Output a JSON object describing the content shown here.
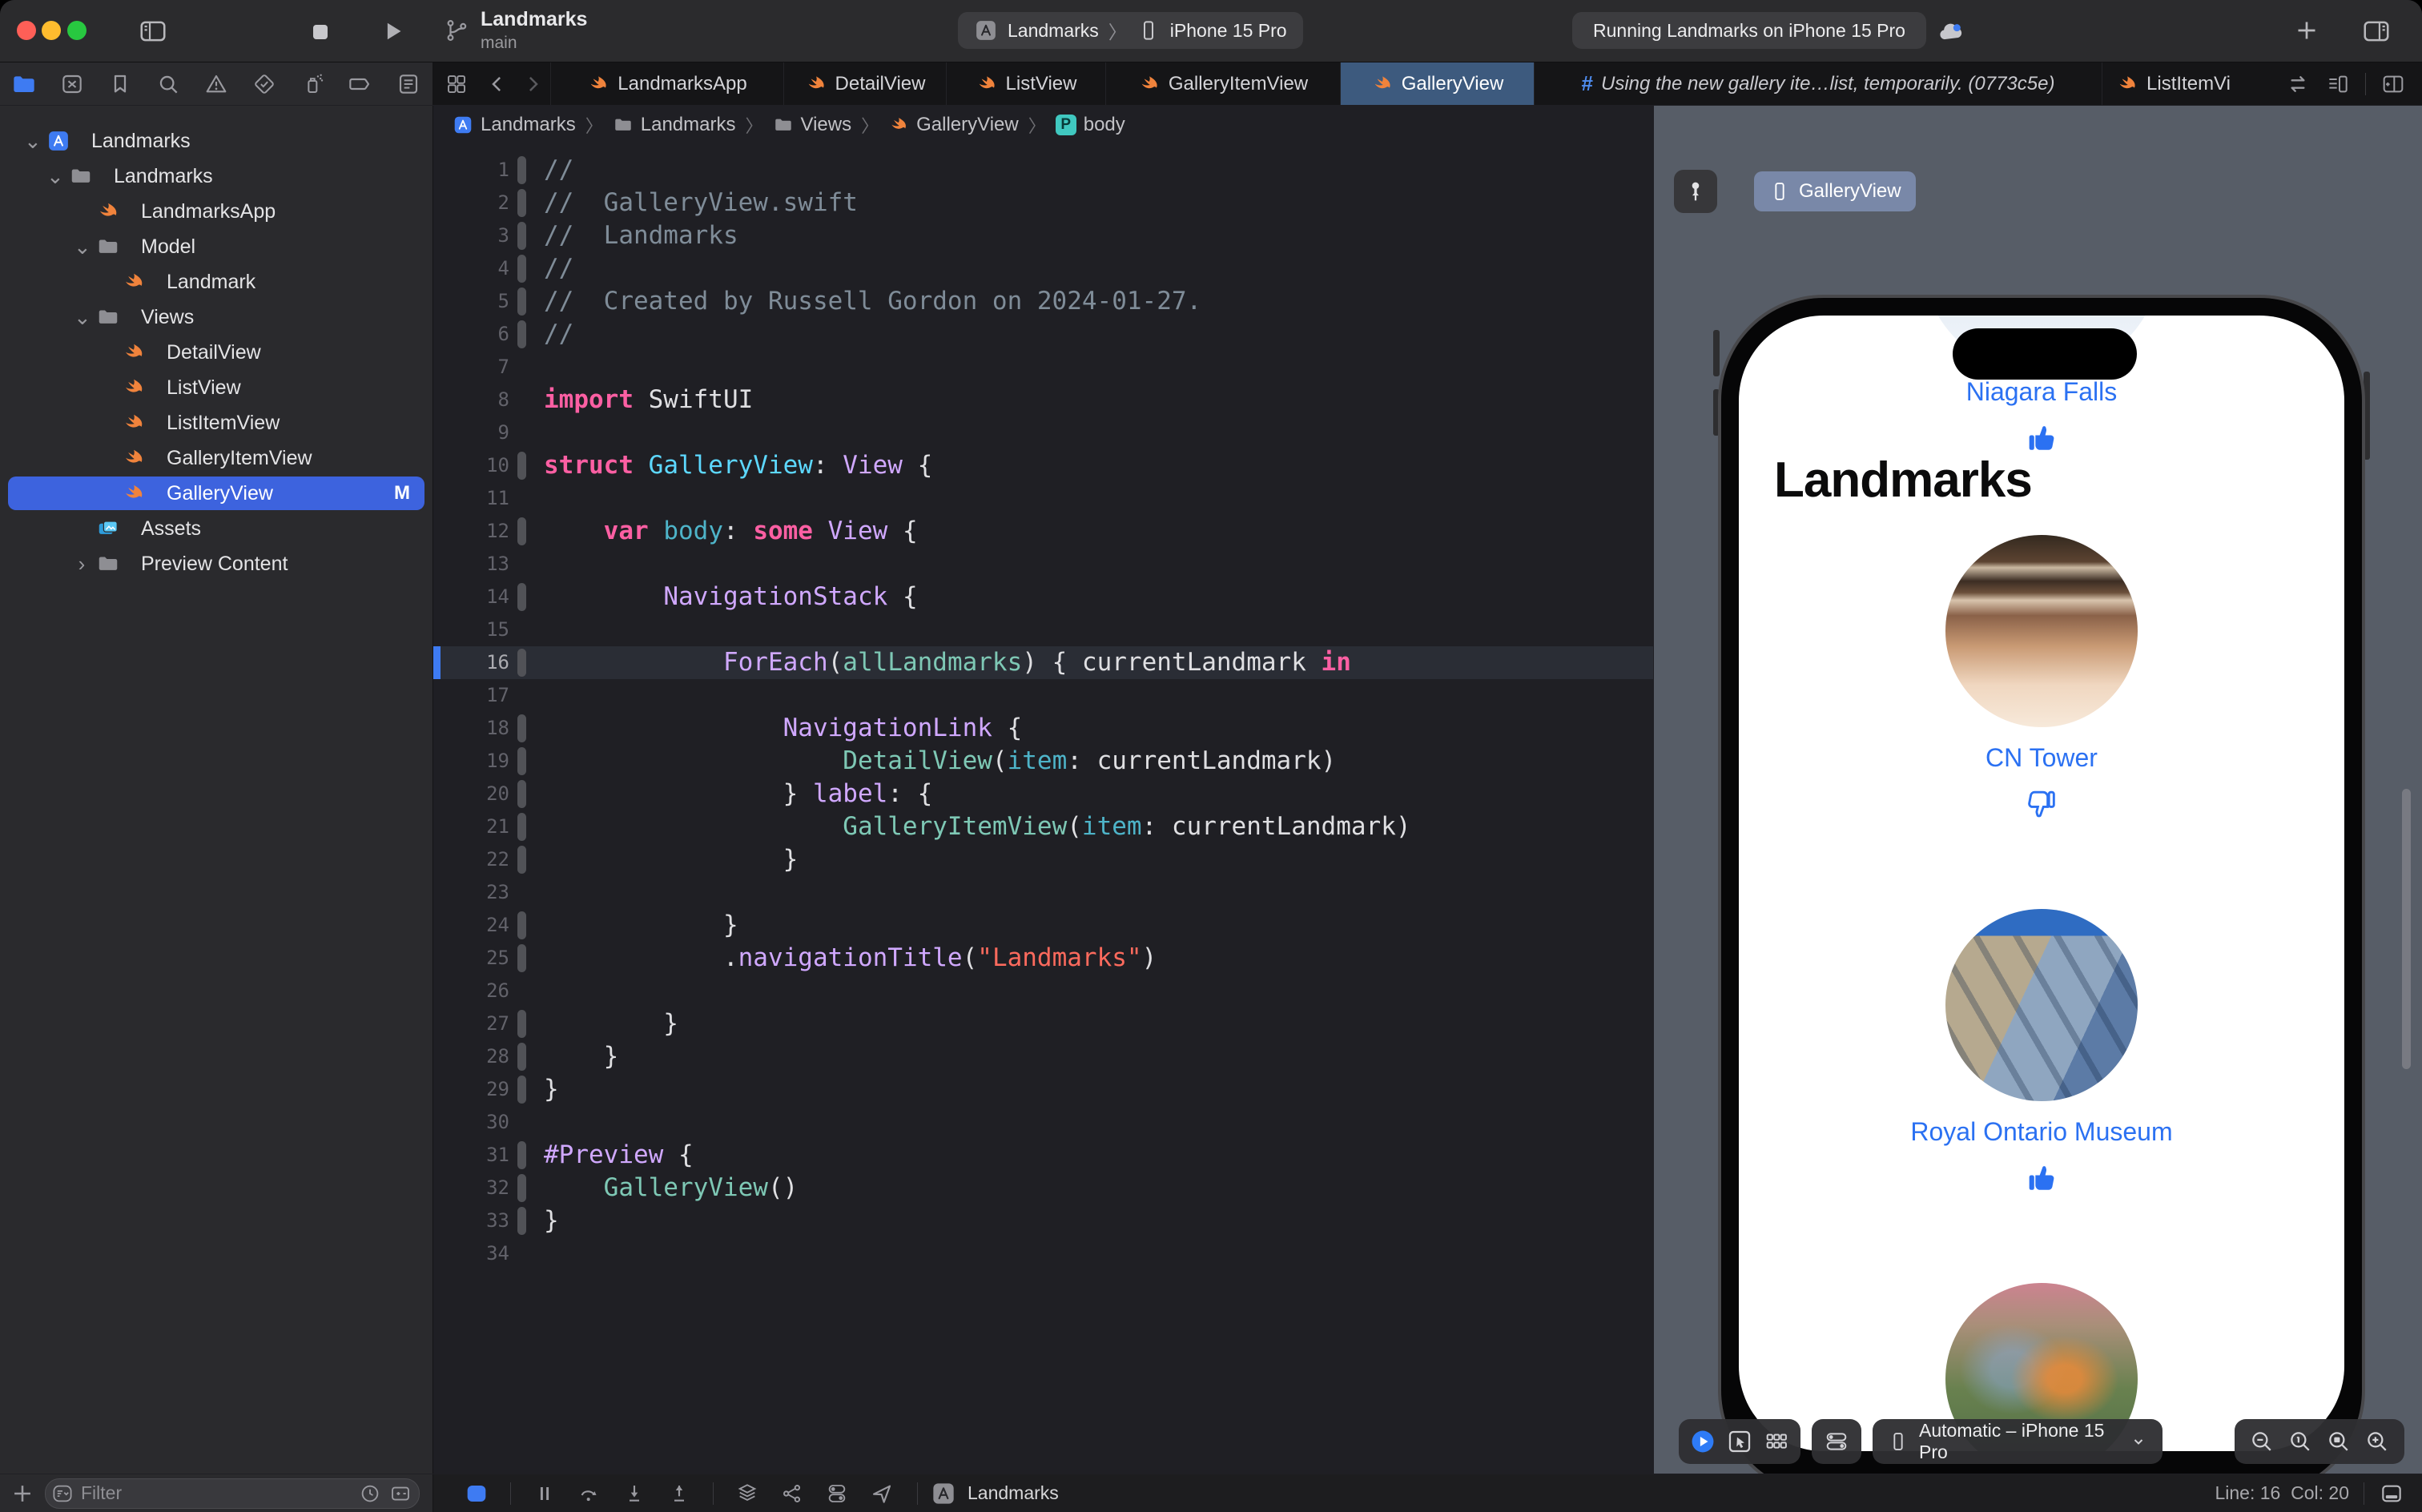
{
  "titlebar": {
    "traffic_lights": [
      "close",
      "minimize",
      "zoom"
    ],
    "toolbar_icons": [
      "sidebar-toggle",
      "stop-button",
      "run-button"
    ],
    "scheme_project": "Landmarks",
    "scheme_branch": "main",
    "run_destination": {
      "app": "Landmarks",
      "separator": "〉",
      "device": "iPhone 15 Pro"
    },
    "activity_status": "Running Landmarks on iPhone 15 Pro",
    "right_icons": [
      "cloud-sync",
      "add-tab",
      "right-panel-toggle"
    ]
  },
  "navigator": {
    "strip": [
      "project-navigator-folder",
      "source-control",
      "bookmarks",
      "find",
      "issues",
      "tests",
      "debug-gauge",
      "breakpoints",
      "reports"
    ],
    "tree": [
      {
        "label": "Landmarks",
        "icon": "appstore",
        "level": 0,
        "chevron": "down"
      },
      {
        "label": "Landmarks",
        "icon": "folder",
        "level": 1,
        "chevron": "down"
      },
      {
        "label": "LandmarksApp",
        "icon": "swift",
        "level": 2
      },
      {
        "label": "Model",
        "icon": "folder",
        "level": 2,
        "chevron": "down"
      },
      {
        "label": "Landmark",
        "icon": "swift",
        "level": 3
      },
      {
        "label": "Views",
        "icon": "folder",
        "level": 2,
        "chevron": "down"
      },
      {
        "label": "DetailView",
        "icon": "swift",
        "level": 3
      },
      {
        "label": "ListView",
        "icon": "swift",
        "level": 3
      },
      {
        "label": "ListItemView",
        "icon": "swift",
        "level": 3
      },
      {
        "label": "GalleryItemView",
        "icon": "swift",
        "level": 3
      },
      {
        "label": "GalleryView",
        "icon": "swift",
        "level": 3,
        "selected": true,
        "badge": "M"
      },
      {
        "label": "Assets",
        "icon": "assets",
        "level": 2
      },
      {
        "label": "Preview Content",
        "icon": "folder",
        "level": 2,
        "chevron": "right"
      }
    ],
    "filter_placeholder": "Filter",
    "filter_icons": [
      "add",
      "filter-menu",
      "clock",
      "add-remove-box"
    ]
  },
  "tabbar": {
    "left_icons": [
      "related-items-grid",
      "back-chevron",
      "forward-chevron"
    ],
    "tabs": [
      {
        "label": "LandmarksApp",
        "icon": "swift"
      },
      {
        "label": "DetailView",
        "icon": "swift"
      },
      {
        "label": "ListView",
        "icon": "swift"
      },
      {
        "label": "GalleryItemView",
        "icon": "swift"
      },
      {
        "label": "GalleryView",
        "icon": "swift",
        "active": true
      },
      {
        "label": "Using the new gallery ite…list, temporarily. (0773c5e)",
        "icon": "hash",
        "italic": true
      },
      {
        "label": "ListItemVi",
        "icon": "swift",
        "clipped": true
      }
    ],
    "right_icons": [
      "swap-editors",
      "editor-options",
      "add-editor"
    ]
  },
  "breadcrumb": {
    "items": [
      {
        "icon": "appstore",
        "label": "Landmarks"
      },
      {
        "icon": "folder",
        "label": "Landmarks"
      },
      {
        "icon": "folder",
        "label": "Views"
      },
      {
        "icon": "swift",
        "label": "GalleryView"
      },
      {
        "icon": "p-badge",
        "label": "body"
      }
    ]
  },
  "editor": {
    "current_line": 16,
    "lines": [
      {
        "n": 1,
        "bar": true,
        "tokens": [
          [
            "cm",
            "//"
          ]
        ]
      },
      {
        "n": 2,
        "bar": true,
        "tokens": [
          [
            "cm",
            "//  GalleryView.swift"
          ]
        ]
      },
      {
        "n": 3,
        "bar": true,
        "tokens": [
          [
            "cm",
            "//  Landmarks"
          ]
        ]
      },
      {
        "n": 4,
        "bar": true,
        "tokens": [
          [
            "cm",
            "//"
          ]
        ]
      },
      {
        "n": 5,
        "bar": true,
        "tokens": [
          [
            "cm",
            "//  Created by Russell Gordon on 2024-01-27."
          ]
        ]
      },
      {
        "n": 6,
        "bar": true,
        "tokens": [
          [
            "cm",
            "//"
          ]
        ]
      },
      {
        "n": 7,
        "bar": false,
        "tokens": []
      },
      {
        "n": 8,
        "bar": false,
        "tokens": [
          [
            "kw",
            "import"
          ],
          [
            "pl",
            " SwiftUI"
          ]
        ]
      },
      {
        "n": 9,
        "bar": false,
        "tokens": []
      },
      {
        "n": 10,
        "bar": true,
        "tokens": [
          [
            "kw",
            "struct"
          ],
          [
            "pl",
            " "
          ],
          [
            "dc",
            "GalleryView"
          ],
          [
            "pl",
            ": "
          ],
          [
            "ty",
            "View"
          ],
          [
            "pl",
            " {"
          ]
        ]
      },
      {
        "n": 11,
        "bar": false,
        "tokens": []
      },
      {
        "n": 12,
        "bar": true,
        "tokens": [
          [
            "pl",
            "    "
          ],
          [
            "kw",
            "var"
          ],
          [
            "pl",
            " "
          ],
          [
            "pr",
            "body"
          ],
          [
            "pl",
            ": "
          ],
          [
            "kw",
            "some"
          ],
          [
            "pl",
            " "
          ],
          [
            "ty",
            "View"
          ],
          [
            "pl",
            " {"
          ]
        ]
      },
      {
        "n": 13,
        "bar": false,
        "tokens": []
      },
      {
        "n": 14,
        "bar": true,
        "tokens": [
          [
            "pl",
            "        "
          ],
          [
            "ty",
            "NavigationStack"
          ],
          [
            "pl",
            " {"
          ]
        ]
      },
      {
        "n": 15,
        "bar": false,
        "tokens": []
      },
      {
        "n": 16,
        "bar": true,
        "tokens": [
          [
            "pl",
            "            "
          ],
          [
            "ty",
            "ForEach"
          ],
          [
            "pl",
            "("
          ],
          [
            "pj",
            "allLandmarks"
          ],
          [
            "pl",
            ") { currentLandmark "
          ],
          [
            "kw",
            "in"
          ]
        ]
      },
      {
        "n": 17,
        "bar": false,
        "tokens": []
      },
      {
        "n": 18,
        "bar": true,
        "tokens": [
          [
            "pl",
            "                "
          ],
          [
            "ty",
            "NavigationLink"
          ],
          [
            "pl",
            " {"
          ]
        ]
      },
      {
        "n": 19,
        "bar": true,
        "tokens": [
          [
            "pl",
            "                    "
          ],
          [
            "pj",
            "DetailView"
          ],
          [
            "pl",
            "("
          ],
          [
            "pm",
            "item"
          ],
          [
            "pl",
            ": currentLandmark)"
          ]
        ]
      },
      {
        "n": 20,
        "bar": true,
        "tokens": [
          [
            "pl",
            "                } "
          ],
          [
            "ty",
            "label"
          ],
          [
            "pl",
            ": {"
          ]
        ]
      },
      {
        "n": 21,
        "bar": true,
        "tokens": [
          [
            "pl",
            "                    "
          ],
          [
            "pj",
            "GalleryItemView"
          ],
          [
            "pl",
            "("
          ],
          [
            "pm",
            "item"
          ],
          [
            "pl",
            ": currentLandmark)"
          ]
        ]
      },
      {
        "n": 22,
        "bar": true,
        "tokens": [
          [
            "pl",
            "                }"
          ]
        ]
      },
      {
        "n": 23,
        "bar": false,
        "tokens": []
      },
      {
        "n": 24,
        "bar": true,
        "tokens": [
          [
            "pl",
            "            }"
          ]
        ]
      },
      {
        "n": 25,
        "bar": true,
        "tokens": [
          [
            "pl",
            "            ."
          ],
          [
            "ty",
            "navigationTitle"
          ],
          [
            "pl",
            "("
          ],
          [
            "st",
            "\"Landmarks\""
          ],
          [
            "pl",
            ")"
          ]
        ]
      },
      {
        "n": 26,
        "bar": false,
        "tokens": []
      },
      {
        "n": 27,
        "bar": true,
        "tokens": [
          [
            "pl",
            "        }"
          ]
        ]
      },
      {
        "n": 28,
        "bar": true,
        "tokens": [
          [
            "pl",
            "    }"
          ]
        ]
      },
      {
        "n": 29,
        "bar": true,
        "tokens": [
          [
            "pl",
            "}"
          ]
        ]
      },
      {
        "n": 30,
        "bar": false,
        "tokens": []
      },
      {
        "n": 31,
        "bar": true,
        "tokens": [
          [
            "ty",
            "#Preview"
          ],
          [
            "pl",
            " {"
          ]
        ]
      },
      {
        "n": 32,
        "bar": true,
        "tokens": [
          [
            "pl",
            "    "
          ],
          [
            "pj",
            "GalleryView"
          ],
          [
            "pl",
            "()"
          ]
        ]
      },
      {
        "n": 33,
        "bar": true,
        "tokens": [
          [
            "pl",
            "}"
          ]
        ]
      },
      {
        "n": 34,
        "bar": false,
        "tokens": []
      }
    ]
  },
  "preview": {
    "pin_icon": "pin",
    "chip_label": "GalleryView",
    "nav_title": "Landmarks",
    "gallery": [
      {
        "name": "Niagara Falls",
        "vote": "thumbs-up",
        "image": "niagara"
      },
      {
        "name": "CN Tower",
        "vote": "thumbs-down",
        "image": "cntower"
      },
      {
        "name": "Royal Ontario Museum",
        "vote": "thumbs-up",
        "image": "rom"
      },
      {
        "name": "",
        "vote": "",
        "image": "park"
      }
    ],
    "toolbar_left_icons": [
      "live-preview-play",
      "selectable-cursor",
      "variants-grid"
    ],
    "toolbar_settings_icon": "device-settings-toggles",
    "device_selector": "Automatic – iPhone 15 Pro",
    "toolbar_zoom_icons": [
      "zoom-out",
      "zoom-100",
      "zoom-fit",
      "zoom-in"
    ]
  },
  "debugbar": {
    "icons": [
      "breakpoints-toggle",
      "pause",
      "step-over",
      "step-into",
      "step-out",
      "view-hierarchy",
      "memory-graph",
      "environment-overrides",
      "simulate-location"
    ],
    "app_label": "Landmarks",
    "line_col": "Line: 16  Col: 20",
    "right_icon": "bottom-panel-toggle"
  },
  "colors": {
    "accent_blue": "#3E7BF2",
    "selection_blue": "#3D63DE",
    "active_tab": "#3D5A7E",
    "link_blue": "#2B71F2",
    "swift_orange": "#F0833C",
    "preview_background": "#575D67"
  }
}
